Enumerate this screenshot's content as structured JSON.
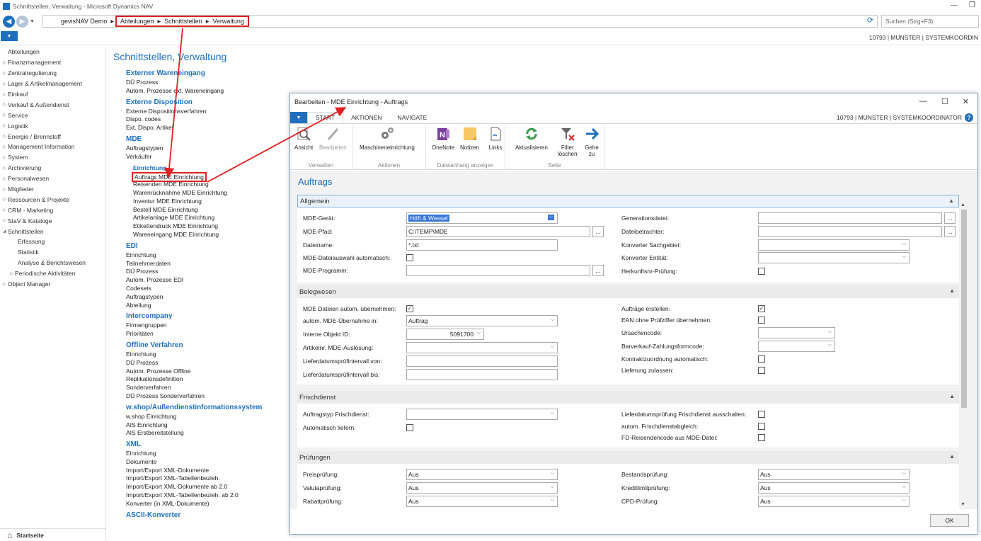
{
  "window": {
    "title": "Schnittstellen, Verwaltung - Microsoft Dynamics NAV",
    "minimize": "—",
    "restore": "❐"
  },
  "address": {
    "company": "gevisNAV Demo",
    "crumbs": [
      "Abteilungen",
      "Schnittstellen",
      "Verwaltung"
    ],
    "search_placeholder": "Suchen (Strg+F3)"
  },
  "user": "10793 | MÜNSTER | SYSTEMKOORDIN",
  "nav": {
    "items": [
      {
        "label": "Abteilungen",
        "tri": ""
      },
      {
        "label": "Finanzmanagement",
        "tri": "▷"
      },
      {
        "label": "Zentralregulierung",
        "tri": "▷"
      },
      {
        "label": "Lager & Artikelmanagement",
        "tri": "▷"
      },
      {
        "label": "Einkauf",
        "tri": "▷"
      },
      {
        "label": "Verkauf & Außendienst",
        "tri": "▷"
      },
      {
        "label": "Service",
        "tri": "▷"
      },
      {
        "label": "Logistik",
        "tri": "▷"
      },
      {
        "label": "Energie / Brennstoff",
        "tri": "▷"
      },
      {
        "label": "Management Information",
        "tri": "▷"
      },
      {
        "label": "System",
        "tri": "▷"
      },
      {
        "label": "Archivierung",
        "tri": "▷"
      },
      {
        "label": "Personalwesen",
        "tri": "▷"
      },
      {
        "label": "Mitglieder",
        "tri": "▷"
      },
      {
        "label": "Ressourcen & Projekte",
        "tri": "▷"
      },
      {
        "label": "CRM - Marketing",
        "tri": "▷"
      },
      {
        "label": "StaV & Kataloge",
        "tri": "▷"
      },
      {
        "label": "Schnittstellen",
        "tri": "◢"
      },
      {
        "label": "Erfassung",
        "tri": "",
        "sub": true
      },
      {
        "label": "Statistik",
        "tri": "",
        "sub": true
      },
      {
        "label": "Analyse & Berichtswesen",
        "tri": "",
        "sub": true
      },
      {
        "label": "Periodische Aktivitäten",
        "tri": "▷",
        "sub": true
      },
      {
        "label": "Object Manager",
        "tri": "▷"
      }
    ],
    "startseite": "Startseite"
  },
  "content": {
    "title": "Schnittstellen, Verwaltung",
    "sections": [
      {
        "head": "Externer Wareneingang",
        "links": [
          "DÜ Prozess",
          "Autom. Prozesse ext. Wareneingang"
        ]
      },
      {
        "head": "Externe Disposition",
        "links": [
          "Externe Dispositionsverfahren",
          "Dispo. codes",
          "Ext. Dispo. Artikel"
        ]
      },
      {
        "head": "MDE",
        "links": [
          "Auftragstypen",
          "Verkäufer"
        ],
        "subhead": "Einrichtung",
        "sublinks": [
          "Auftrags MDE Einrichtung",
          "Reisenden MDE Einrichtung",
          "Warenrücknahme MDE Einrichtung",
          "Inventur MDE Einrichtung",
          "Bestell MDE Einrichtung",
          "Artikelanlage MDE Einrichtung",
          "Etikettendruck MDE Einrichtung",
          "Wareneingang MDE Einrichtung"
        ]
      },
      {
        "head": "EDI",
        "links": [
          "Einrichtung",
          "Teilnehmerdaten",
          "DÜ Prozess",
          "Autom. Prozesse EDI",
          "Codesets",
          "Auftragstypen",
          "Abteilung"
        ]
      },
      {
        "head": "Intercompany",
        "links": [
          "Firmengruppen",
          "Prioritäten"
        ]
      },
      {
        "head": "Offline Verfahren",
        "links": [
          "Einrichtung",
          "DÜ Prozess",
          "Autom. Prozesse Offline",
          "Replikationsdefinition",
          "Sonderverfahren",
          "DÜ Prozess Sonderverfahren"
        ]
      },
      {
        "head": "w.shop/Außendienstinformationssystem",
        "links": [
          "w.shop Einrichtung",
          "AIS Einrichtung",
          "AIS Erstbereitstellung"
        ]
      },
      {
        "head": "XML",
        "links": [
          "Einrichtung",
          "Dokumente",
          "Import/Export XML-Dokumente",
          "Import/Export XML-Tabellenbezieh.",
          "Import/Export XML-Dokumente ab 2.0",
          "Import/Export XML-Tabellenbezieh. ab 2.0",
          "Konverter (in XML-Dokumente)"
        ]
      },
      {
        "head": "ASCII-Konverter",
        "links": []
      }
    ]
  },
  "dialog": {
    "title": "Bearbeiten - MDE Einrichtung - Auftrags",
    "tabs": [
      "START",
      "AKTIONEN",
      "NAVIGATE"
    ],
    "user": "10793 | MÜNSTER | SYSTEMKOORDINATOR",
    "ribbon": {
      "groups": [
        "Verwalten",
        "Aktionen",
        "Dateianhang anzeigen",
        "Seite"
      ],
      "buttons": {
        "ansicht": "Ansicht",
        "bearbeiten": "Bearbeiten",
        "maschine": "Maschineneinrichtung",
        "onenote": "OneNote",
        "notizen": "Notizen",
        "links": "Links",
        "aktualisieren": "Aktualisieren",
        "filter1": "Filter",
        "filter2": "löschen",
        "gehe1": "Gehe",
        "gehe2": "zu"
      }
    },
    "heading": "Auftrags",
    "allgemein": {
      "title": "Allgemein",
      "mde_geraet_label": "MDE-Gerät:",
      "mde_geraet": "Höft & Wessel",
      "mde_pfad_label": "MDE-Pfad:",
      "mde_pfad": "C:\\TEMP\\MDE",
      "dateiname_label": "Dateiname:",
      "dateiname": "*.txt",
      "auto_label": "MDE-Dateiauswahl automatisch:",
      "programm_label": "MDE-Programm:",
      "generationsdatei_label": "Generationsdatei:",
      "dateibetrachter_label": "Dateibetrachter:",
      "konverter_sg_label": "Konverter Sachgebiet:",
      "konverter_ent_label": "Konverter Entität:",
      "herkunft_label": "Herkunftsnr-Prüfung:"
    },
    "belegwesen": {
      "title": "Belegwesen",
      "autom_label": "MDE Dateien autom. übernehmen:",
      "uebernahme_label": "autom. MDE-Übernahme in:",
      "uebernahme": "Auftrag",
      "objekt_label": "Interne Objekt ID:",
      "objekt": "5091700",
      "artikel_label": "Artikelnr. MDE-Auslösung:",
      "von_label": "Lieferdatumsprüfintervall von:",
      "bis_label": "Lieferdatumsprüfintervall bis:",
      "auftraege_label": "Aufträge erstellen:",
      "ean_label": "EAN ohne Prüfziffer übernehmen:",
      "ursache_label": "Ursachencode:",
      "barverkauf_label": "Barverkauf-Zahlungsformcode:",
      "kontrakt_label": "Kontraktzuordnung automatisch:",
      "lieferung_label": "Lieferung zulassen:"
    },
    "frischdienst": {
      "title": "Frischdienst",
      "typ_label": "Auftragstyp Frischdienst:",
      "liefern_label": "Automatisch liefern:",
      "ldp_label": "Lieferdatumsprüfung Frischdienst ausschalten:",
      "abgleich_label": "autom. Frischdienstabgleich:",
      "fdcode_label": "FD-Reisendencode aus MDE-Datei:"
    },
    "pruefungen": {
      "title": "Prüfungen",
      "preis_label": "Preisprüfung:",
      "preis": "Aus",
      "valuta_label": "Valutaprüfung:",
      "valuta": "Aus",
      "rabatt_label": "Rabattprüfung:",
      "rabatt": "Aus",
      "bestand_label": "Bestandsprüfung:",
      "bestand": "Aus",
      "kredit_label": "Kreditlimitprüfung:",
      "kredit": "Aus",
      "cpd_label": "CPD-Prüfung:",
      "cpd": "Aus"
    },
    "ok": "OK"
  },
  "colors": {
    "accent": "#1f6fbf",
    "highlight": "#e02020"
  }
}
